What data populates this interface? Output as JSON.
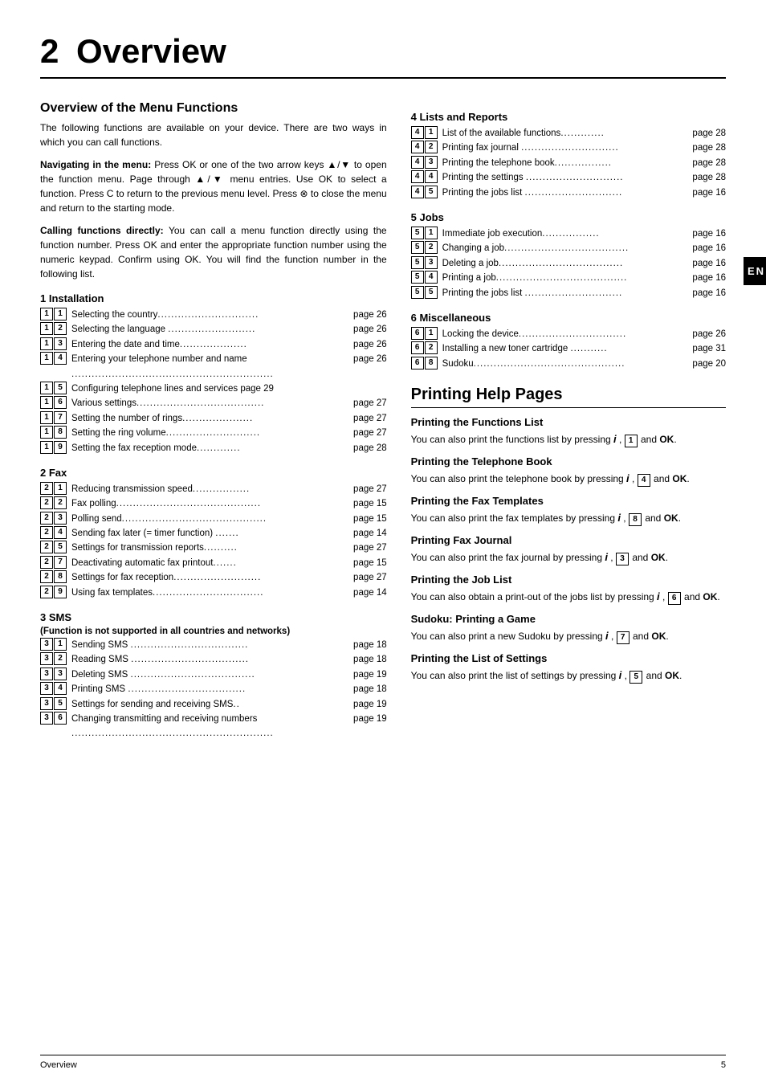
{
  "page": {
    "chapter_number": "2",
    "chapter_title": "Overview",
    "footer_left": "Overview",
    "footer_right": "5",
    "en_tab": "EN"
  },
  "left_col": {
    "section1_title": "Overview of the Menu Functions",
    "intro1": "The following functions are available on your device. There are two ways in which you can call functions.",
    "nav_label": "Navigating in the menu:",
    "nav_text": " Press OK or one of the two arrow keys ▲/▼ to open the function menu. Page through ▲/▼ menu entries. Use OK to select a function. Press C to return to the previous menu level. Press ⊗ to close the menu and return to the starting mode.",
    "call_label": "Calling functions directly:",
    "call_text": " You can call a menu function directly using the function number. Press OK and enter the appropriate function number using the numeric keypad. Confirm using OK. You will find the function number in the following list.",
    "section_installation": "1 Installation",
    "installation_items": [
      {
        "keys": [
          "1",
          "1"
        ],
        "text": "Selecting the country",
        "page": "page 26"
      },
      {
        "keys": [
          "1",
          "2"
        ],
        "text": "Selecting the language",
        "page": "page 26"
      },
      {
        "keys": [
          "1",
          "3"
        ],
        "text": "Entering the date and time",
        "page": "page 26"
      },
      {
        "keys": [
          "1",
          "4"
        ],
        "text": "Entering your telephone number and name",
        "page": "page 26"
      },
      {
        "keys": [
          "1",
          "5"
        ],
        "text": "Configuring telephone lines and services",
        "page": "page 29"
      },
      {
        "keys": [
          "1",
          "6"
        ],
        "text": "Various settings",
        "page": "page 27"
      },
      {
        "keys": [
          "1",
          "7"
        ],
        "text": "Setting the number of rings",
        "page": "page 27"
      },
      {
        "keys": [
          "1",
          "8"
        ],
        "text": "Setting the ring volume",
        "page": "page 27"
      },
      {
        "keys": [
          "1",
          "9"
        ],
        "text": "Setting the fax reception mode",
        "page": "page 28"
      }
    ],
    "section_fax": "2 Fax",
    "fax_items": [
      {
        "keys": [
          "2",
          "1"
        ],
        "text": "Reducing transmission speed",
        "page": "page 27"
      },
      {
        "keys": [
          "2",
          "2"
        ],
        "text": "Fax polling",
        "page": "page 15"
      },
      {
        "keys": [
          "2",
          "3"
        ],
        "text": "Polling send",
        "page": "page 15"
      },
      {
        "keys": [
          "2",
          "4"
        ],
        "text": "Sending fax later (= timer function)",
        "page": "page 14"
      },
      {
        "keys": [
          "2",
          "5"
        ],
        "text": "Settings for transmission reports",
        "page": "page 27"
      },
      {
        "keys": [
          "2",
          "7"
        ],
        "text": "Deactivating automatic fax printout",
        "page": "page 15"
      },
      {
        "keys": [
          "2",
          "8"
        ],
        "text": "Settings for fax reception",
        "page": "page 27"
      },
      {
        "keys": [
          "2",
          "9"
        ],
        "text": "Using fax templates",
        "page": "page 14"
      }
    ],
    "section_sms": "3 SMS",
    "sms_note": "(Function is not supported in all countries and networks)",
    "sms_items": [
      {
        "keys": [
          "3",
          "1"
        ],
        "text": "Sending SMS",
        "page": "page 18"
      },
      {
        "keys": [
          "3",
          "2"
        ],
        "text": "Reading SMS",
        "page": "page 18"
      },
      {
        "keys": [
          "3",
          "3"
        ],
        "text": "Deleting SMS",
        "page": "page 19"
      },
      {
        "keys": [
          "3",
          "4"
        ],
        "text": "Printing SMS",
        "page": "page 18"
      },
      {
        "keys": [
          "3",
          "5"
        ],
        "text": "Settings for sending and receiving SMS",
        "page": "page 19"
      },
      {
        "keys": [
          "3",
          "6"
        ],
        "text": "Changing transmitting and receiving numbers",
        "page": "page 19"
      }
    ]
  },
  "right_col": {
    "section4_title": "4 Lists and Reports",
    "lists_items": [
      {
        "keys": [
          "4",
          "1"
        ],
        "text": "List of the available functions",
        "page": "page 28"
      },
      {
        "keys": [
          "4",
          "2"
        ],
        "text": "Printing fax journal",
        "page": "page 28"
      },
      {
        "keys": [
          "4",
          "3"
        ],
        "text": "Printing the telephone book",
        "page": "page 28"
      },
      {
        "keys": [
          "4",
          "4"
        ],
        "text": "Printing the settings",
        "page": "page 28"
      },
      {
        "keys": [
          "4",
          "5"
        ],
        "text": "Printing the jobs list",
        "page": "page 16"
      }
    ],
    "section5_title": "5 Jobs",
    "jobs_items": [
      {
        "keys": [
          "5",
          "1"
        ],
        "text": "Immediate job execution",
        "page": "page 16"
      },
      {
        "keys": [
          "5",
          "2"
        ],
        "text": "Changing a job",
        "page": "page 16"
      },
      {
        "keys": [
          "5",
          "3"
        ],
        "text": "Deleting a job",
        "page": "page 16"
      },
      {
        "keys": [
          "5",
          "4"
        ],
        "text": "Printing a job",
        "page": "page 16"
      },
      {
        "keys": [
          "5",
          "5"
        ],
        "text": "Printing the jobs list",
        "page": "page 16"
      }
    ],
    "section6_title": "6 Miscellaneous",
    "misc_items": [
      {
        "keys": [
          "6",
          "1"
        ],
        "text": "Locking the device",
        "page": "page 26"
      },
      {
        "keys": [
          "6",
          "2"
        ],
        "text": "Installing a new toner cartridge",
        "page": "page 31"
      },
      {
        "keys": [
          "6",
          "8"
        ],
        "text": "Sudoku",
        "page": "page 20"
      }
    ],
    "print_section_title": "Printing Help Pages",
    "print_subsections": [
      {
        "title": "Printing the Functions List",
        "text": "You can also print the functions list by pressing",
        "i": "i",
        "keys": [
          "1"
        ],
        "suffix": "and OK."
      },
      {
        "title": "Printing the Telephone Book",
        "text": "You can also print the telephone book by pressing",
        "i": "i",
        "keys": [
          "4"
        ],
        "suffix": "and OK."
      },
      {
        "title": "Printing the Fax Templates",
        "text": "You can also print the fax templates by pressing",
        "i": "i",
        "keys": [
          "8"
        ],
        "suffix": "and OK."
      },
      {
        "title": "Printing Fax Journal",
        "text": "You can also print the fax journal by pressing",
        "i": "i",
        "keys": [
          "3"
        ],
        "suffix": "and OK."
      },
      {
        "title": "Printing the Job List",
        "text": "You can also obtain a print-out of the jobs list by pressing",
        "i": "i",
        "keys": [
          "6"
        ],
        "suffix": "and OK."
      },
      {
        "title": "Sudoku: Printing a Game",
        "text": "You can also print a new Sudoku by pressing",
        "i": "i",
        "keys": [
          "7"
        ],
        "suffix": "and OK."
      },
      {
        "title": "Printing the List of Settings",
        "text": "You can also print the list of settings by pressing",
        "i": "i",
        "keys": [
          "5"
        ],
        "suffix": "and OK."
      }
    ]
  }
}
